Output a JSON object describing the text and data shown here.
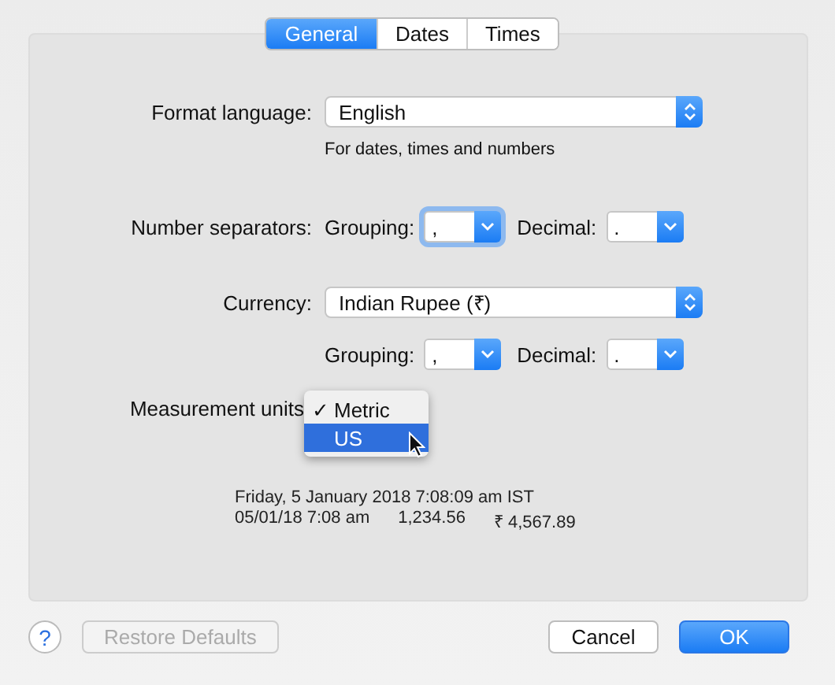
{
  "tabs": [
    {
      "label": "General",
      "selected": true
    },
    {
      "label": "Dates",
      "selected": false
    },
    {
      "label": "Times",
      "selected": false
    }
  ],
  "format_language": {
    "label": "Format language:",
    "value": "English",
    "hint": "For dates, times and numbers"
  },
  "number_separators": {
    "label": "Number separators:",
    "grouping_label": "Grouping:",
    "grouping": ",",
    "grouping_focused": true,
    "decimal_label": "Decimal:",
    "decimal": "."
  },
  "currency": {
    "label": "Currency:",
    "value": "Indian Rupee (₹)",
    "grouping_label": "Grouping:",
    "grouping": ",",
    "grouping_focused": false,
    "decimal_label": "Decimal:",
    "decimal": "."
  },
  "measurement_units": {
    "label": "Measurement units",
    "check": "✓",
    "menu": [
      {
        "label": "Metric",
        "checked": true,
        "selected": false
      },
      {
        "label": "US",
        "checked": false,
        "selected": true
      }
    ]
  },
  "samples": {
    "line_1": "Friday, 5 January 2018 7:08:09 am IST",
    "line_2": [
      "05/01/18 7:08 am",
      "1,234.56",
      "₹ 4,567.89"
    ]
  },
  "footer": {
    "help": "?",
    "buttons": [
      {
        "label": "Restore Defaults",
        "kind": "secondary",
        "disabled": true
      },
      {
        "label": "Cancel",
        "kind": "secondary",
        "disabled": false
      },
      {
        "label": "OK",
        "kind": "default",
        "disabled": false
      }
    ]
  }
}
